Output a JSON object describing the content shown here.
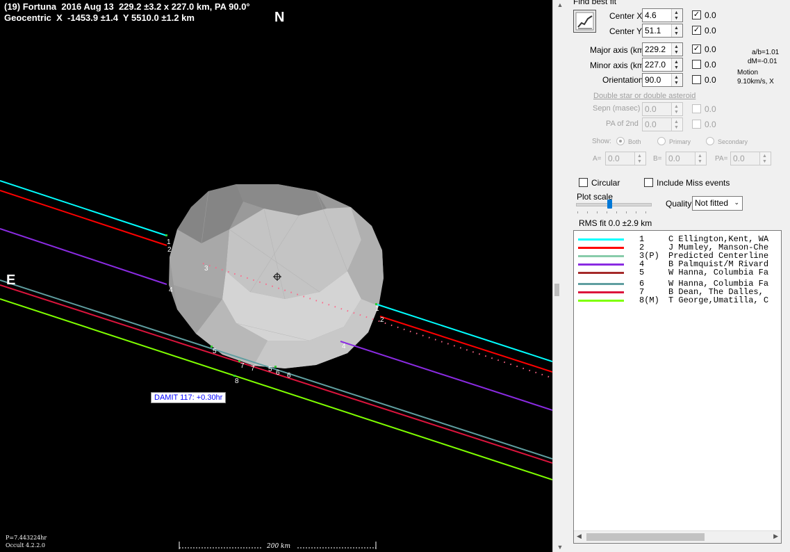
{
  "plot": {
    "title_line1": "(19) Fortuna  2016 Aug 13  229.2 ±3.2 x 227.0 km, PA 90.0°",
    "title_line2": "Geocentric  X  -1453.9 ±1.4  Y 5510.0 ±1.2 km",
    "north_label": "N",
    "east_label": "E",
    "damit_label": "DAMIT 117: +0.30hr",
    "period_label": "P=7.443224hr",
    "version_label": "Occult 4.2.2.0",
    "scale_label": "200 km",
    "chord_labels": [
      "1",
      "2",
      "3",
      "4",
      "5",
      "6",
      "7",
      "8"
    ]
  },
  "panel": {
    "find_best_fit": "Find best fit",
    "center_x": {
      "label": "Center X",
      "value": "4.6",
      "checked": true,
      "unc": "0.0"
    },
    "center_y": {
      "label": "Center Y",
      "value": "51.1",
      "checked": true,
      "unc": "0.0"
    },
    "major_axis": {
      "label": "Major axis (km)",
      "value": "229.2",
      "checked": true,
      "unc": "0.0"
    },
    "minor_axis": {
      "label": "Minor axis (km)",
      "value": "227.0",
      "checked": false,
      "unc": "0.0"
    },
    "orientation": {
      "label": "Orientation",
      "value": "90.0",
      "checked": false,
      "unc": "0.0"
    },
    "ab_ratio": "a/b=1.01",
    "dm": "dM=-0.01",
    "motion_label": "Motion",
    "motion_value": "9.10km/s, X",
    "double_star_link": "Double star  or  double asteroid",
    "sepn": {
      "label": "Sepn (masec)",
      "value": "0.0",
      "unc": "0.0"
    },
    "pa2": {
      "label": "PA of 2nd",
      "value": "0.0",
      "unc": "0.0"
    },
    "show_label": "Show:",
    "show_options": [
      "Both",
      "Primary",
      "Secondary"
    ],
    "a_label": "A=",
    "a_value": "0.0",
    "b_label": "B=",
    "b_value": "0.0",
    "pa_label": "PA=",
    "pa_value": "0.0",
    "circular_label": "Circular",
    "include_miss_label": "Include Miss events",
    "plot_scale_label": "Plot scale",
    "plot_scale_value": 0.42,
    "quality_label": "Quality",
    "quality_value": "Not fitted",
    "rms_fit": "RMS fit 0.0 ±2.9 km"
  },
  "legend": [
    {
      "num": "1",
      "name": "C Ellington,Kent, WA",
      "color": "#00ffff"
    },
    {
      "num": "2",
      "name": "J Mumley, Manson-Che",
      "color": "#ff0000"
    },
    {
      "num": "3(P)",
      "name": "Predicted Centerline",
      "color": "#88ccaa"
    },
    {
      "num": "4",
      "name": "B Palmquist/M Rivard",
      "color": "#8a2be2"
    },
    {
      "num": "5",
      "name": "W Hanna, Columbia Fa",
      "color": "#a52a2a"
    },
    {
      "num": "6",
      "name": "W Hanna, Columbia Fa",
      "color": "#5f9ea0"
    },
    {
      "num": "7",
      "name": "B Dean, The Dalles,",
      "color": "#dc143c"
    },
    {
      "num": "8(M)",
      "name": "T George,Umatilla, C",
      "color": "#7fff00"
    }
  ]
}
